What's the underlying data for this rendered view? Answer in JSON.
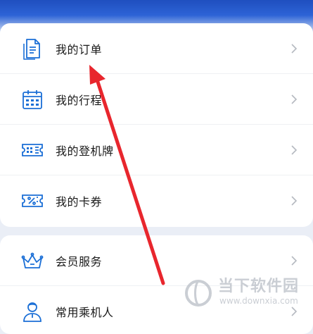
{
  "menu_group_1": [
    {
      "label": "我的订单",
      "icon": "order-document-icon"
    },
    {
      "label": "我的行程",
      "icon": "calendar-icon"
    },
    {
      "label": "我的登机牌",
      "icon": "boarding-pass-icon"
    },
    {
      "label": "我的卡券",
      "icon": "coupon-ticket-icon"
    }
  ],
  "menu_group_2": [
    {
      "label": "会员服务",
      "icon": "crown-icon"
    },
    {
      "label": "常用乘机人",
      "icon": "passenger-person-icon"
    }
  ],
  "watermark": {
    "name": "当下软件园",
    "url": "www.downxia.com"
  },
  "colors": {
    "accent": "#1b6fd6",
    "annotation_arrow": "#e8262d",
    "header_blue": "#1f4fbf"
  }
}
